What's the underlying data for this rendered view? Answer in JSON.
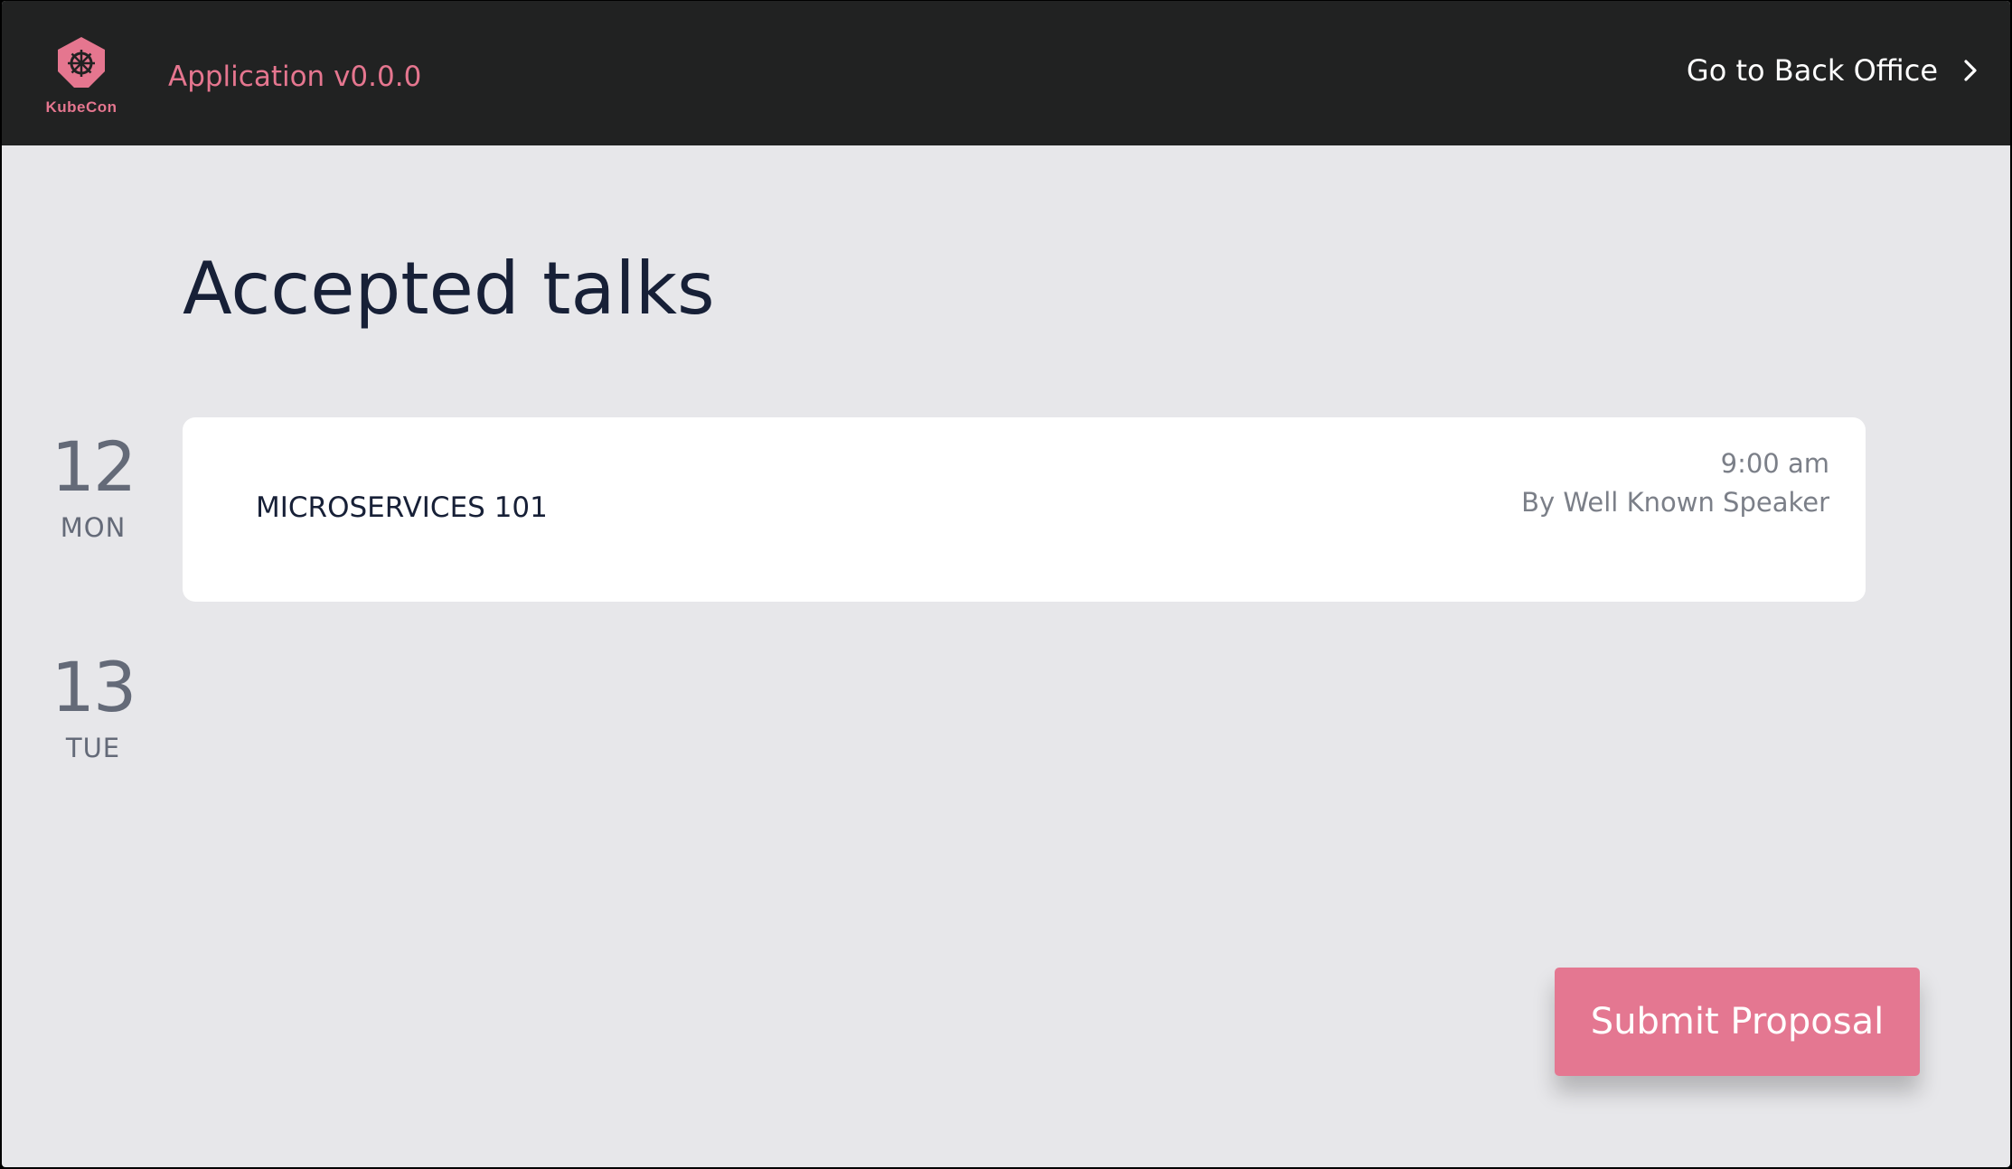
{
  "header": {
    "logo_text": "KubeCon",
    "app_version": "Application v0.0.0",
    "back_office_label": "Go to Back Office"
  },
  "main": {
    "title": "Accepted talks",
    "days": [
      {
        "number": "12",
        "weekday": "MON"
      },
      {
        "number": "13",
        "weekday": "TUE"
      }
    ],
    "talks": [
      {
        "title": "MICROSERVICES 101",
        "time": "9:00 am",
        "speaker": "By Well Known Speaker"
      }
    ],
    "submit_label": "Submit Proposal"
  },
  "colors": {
    "accent": "#e47791",
    "header_bg": "#212222",
    "page_bg": "#e7e7ea",
    "title_text": "#172037"
  },
  "icons": {
    "logo": "kubecon-helm-icon",
    "back_office": "chevron-right-icon"
  }
}
